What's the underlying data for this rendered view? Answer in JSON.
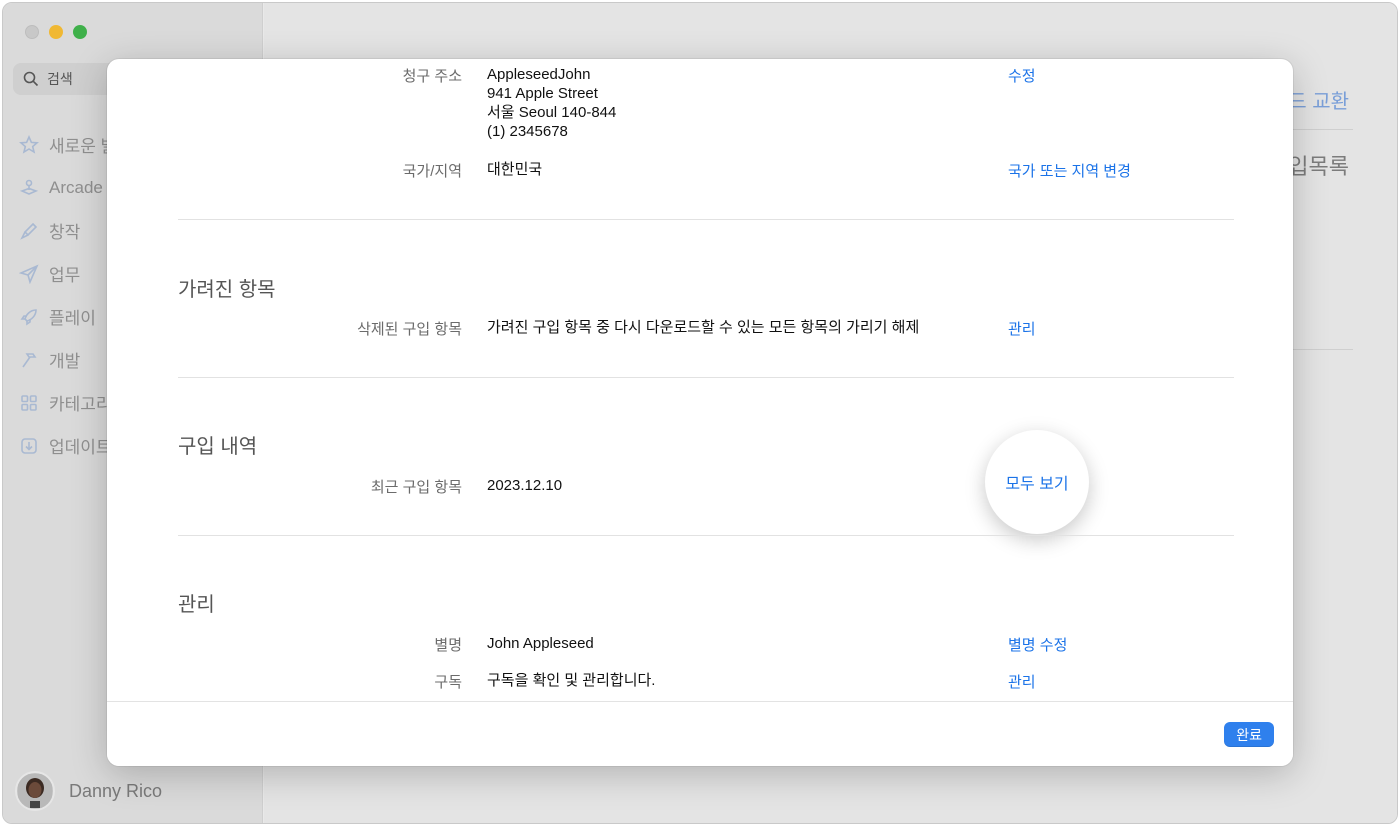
{
  "background": {
    "search_placeholder": "검색",
    "sidebar_items": [
      {
        "label": "새로운 발",
        "icon": "star-icon"
      },
      {
        "label": "Arcade",
        "icon": "joystick-icon"
      },
      {
        "label": "창작",
        "icon": "brush-icon"
      },
      {
        "label": "업무",
        "icon": "paperplane-icon"
      },
      {
        "label": "플레이",
        "icon": "rocket-icon"
      },
      {
        "label": "개발",
        "icon": "hammer-icon"
      },
      {
        "label": "카테고리",
        "icon": "grid-icon"
      },
      {
        "label": "업데이트",
        "icon": "download-icon"
      }
    ],
    "user_name": "Danny Rico",
    "main_link": "드 교환",
    "main_title": "입목록"
  },
  "modal": {
    "billing": {
      "label": "청구 주소",
      "lines": [
        "AppleseedJohn",
        "941 Apple Street",
        "서울 Seoul 140-844",
        "(1) 2345678"
      ],
      "action": "수정"
    },
    "country": {
      "label": "국가/지역",
      "value": "대한민국",
      "action": "국가 또는 지역 변경"
    },
    "hidden_section": {
      "title": "가려진 항목",
      "label": "삭제된 구입 항목",
      "value": "가려진 구입 항목 중 다시 다운로드할 수 있는 모든 항목의 가리기 해제",
      "action": "관리"
    },
    "purchase_section": {
      "title": "구입 내역",
      "label": "최근 구입 항목",
      "value": "2023.12.10",
      "action": "모두 보기"
    },
    "manage_section": {
      "title": "관리",
      "nickname_label": "별명",
      "nickname_value": "John Appleseed",
      "nickname_action": "별명 수정",
      "subscription_label": "구독",
      "subscription_value": "구독을 확인 및 관리합니다.",
      "subscription_action": "관리"
    },
    "done_label": "완료"
  },
  "colors": {
    "accent": "#1b73e8",
    "button": "#2f80ed"
  }
}
